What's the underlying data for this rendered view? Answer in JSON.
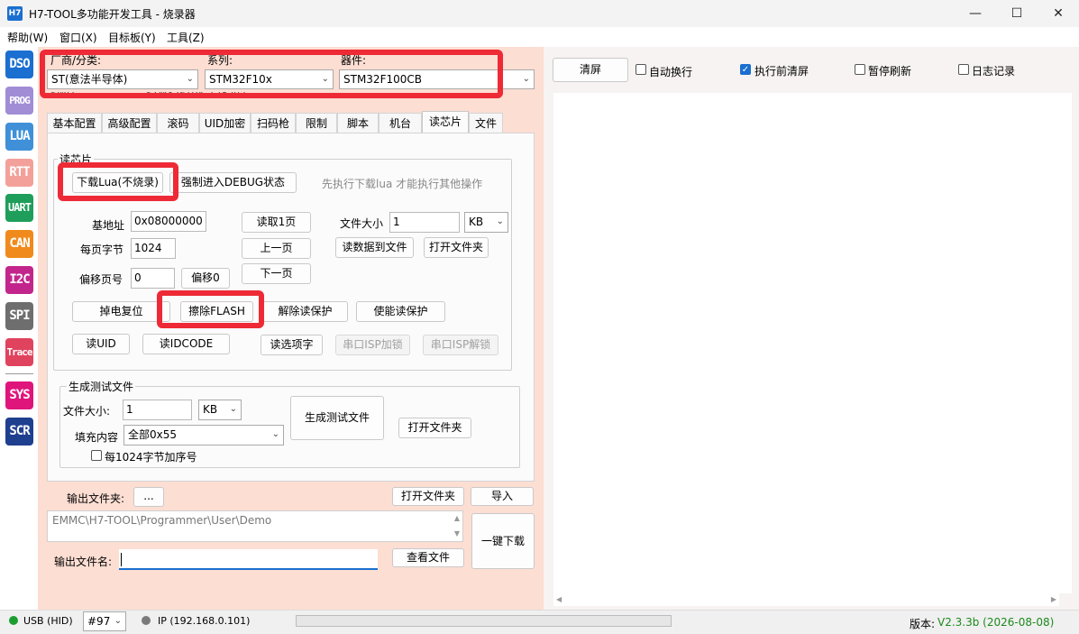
{
  "window": {
    "logo": "H7",
    "title": "H7-TOOL多功能开发工具 - 烧录器",
    "minimize": "—",
    "maximize": "☐",
    "close": "✕"
  },
  "menu": [
    "帮助(W)",
    "窗口(X)",
    "目标板(Y)",
    "工具(Z)"
  ],
  "sidebar": [
    {
      "label": "DSO",
      "color": "#1a6fd0"
    },
    {
      "label": "PROG",
      "color": "#a08dd6"
    },
    {
      "label": "LUA",
      "color": "#3f90d8"
    },
    {
      "label": "RTT",
      "color": "#f4a09a"
    },
    {
      "label": "UART",
      "color": "#1e9e5a"
    },
    {
      "label": "CAN",
      "color": "#f08a1c"
    },
    {
      "label": "I2C",
      "color": "#c2268c"
    },
    {
      "label": "SPI",
      "color": "#6e6e6e"
    },
    {
      "label": "Trace",
      "color": "#e0435e"
    },
    {
      "label": "SYS",
      "color": "#e0157c"
    },
    {
      "label": "SCR",
      "color": "#1f3f8f"
    }
  ],
  "device_select": {
    "vendor_label": "厂商/分类:",
    "vendor_value": "ST(意法半导体)",
    "series_label": "系列:",
    "series_value": "STM32F10x",
    "device_label": "器件:",
    "device_value": "STM32F100CB",
    "behind_text_1": "SWD",
    "behind_text_2": "STM32F10x_128.lua"
  },
  "tabs": [
    {
      "label": "基本配置",
      "active": false
    },
    {
      "label": "高级配置",
      "active": false
    },
    {
      "label": "滚码",
      "active": false
    },
    {
      "label": "UID加密",
      "active": false
    },
    {
      "label": "扫码枪",
      "active": false
    },
    {
      "label": "限制",
      "active": false
    },
    {
      "label": "脚本",
      "active": false
    },
    {
      "label": "机台",
      "active": false
    },
    {
      "label": "读芯片",
      "active": true
    },
    {
      "label": "文件",
      "active": false
    }
  ],
  "read_chip": {
    "group_title": "读芯片",
    "download_lua": "下载Lua(不烧录)",
    "force_debug": "强制进入DEBUG状态",
    "hint": "先执行下载lua 才能执行其他操作",
    "base_addr_label": "基地址",
    "base_addr_value": "0x08000000",
    "page_bytes_label": "每页字节",
    "page_bytes_value": "1024",
    "offset_page_label": "偏移页号",
    "offset_page_value": "0",
    "offset0_btn": "偏移0",
    "read_page_btn": "读取1页",
    "prev_page_btn": "上一页",
    "next_page_btn": "下一页",
    "file_size_label": "文件大小",
    "file_size_value": "1",
    "file_size_unit": "KB",
    "read_to_file_btn": "读数据到文件",
    "open_folder_btn": "打开文件夹",
    "power_reset_btn": "掉电复位",
    "erase_flash_btn": "擦除FLASH",
    "remove_protect_btn": "解除读保护",
    "enable_protect_btn": "使能读保护",
    "read_uid_btn": "读UID",
    "read_idcode_btn": "读IDCODE",
    "read_option_btn": "读选项字",
    "isp_lock_btn": "串口ISP加锁",
    "isp_unlock_btn": "串口ISP解锁"
  },
  "gen_test": {
    "group_title": "生成测试文件",
    "file_size_label": "文件大小:",
    "file_size_value": "1",
    "file_size_unit": "KB",
    "fill_label": "填充内容",
    "fill_value": "全部0x55",
    "seq_checkbox": "每1024字节加序号",
    "gen_btn": "生成测试文件",
    "open_folder_btn": "打开文件夹"
  },
  "output": {
    "folder_label": "输出文件夹:",
    "browse_btn": "...",
    "open_folder_btn": "打开文件夹",
    "import_btn": "导入",
    "path_value": "EMMC\\H7-TOOL\\Programmer\\User\\Demo",
    "one_key_btn": "一键下载",
    "filename_label": "输出文件名:",
    "filename_value": "",
    "view_file_btn": "查看文件"
  },
  "log_toolbar": {
    "clear_btn": "清屏",
    "auto_wrap": "自动换行",
    "clear_before": "执行前清屏",
    "pause_refresh": "暂停刷新",
    "log_record": "日志记录"
  },
  "status": {
    "usb_label": "USB (HID)",
    "usb_color": "#1b9e2f",
    "device_no": "#97",
    "ip_label": "IP (192.168.0.101)",
    "ip_color": "#7a7a7a",
    "version_label": "版本:",
    "version_value": "V2.3.3b (2026-08-08)",
    "version_color": "#1b8a1b"
  }
}
